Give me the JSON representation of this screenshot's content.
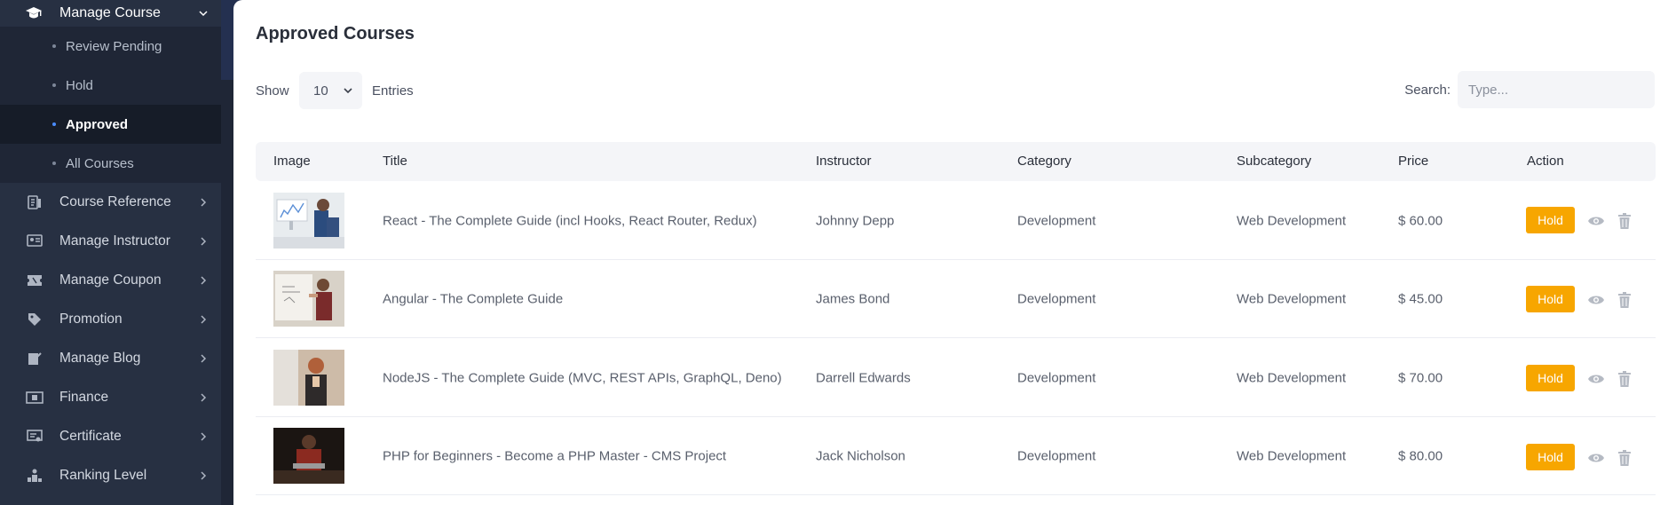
{
  "sidebar": {
    "parent": {
      "label": "Manage Course",
      "icon": "graduation-cap-icon"
    },
    "subitems": [
      {
        "label": "Review Pending"
      },
      {
        "label": "Hold"
      },
      {
        "label": "Approved",
        "active": true
      },
      {
        "label": "All Courses"
      }
    ],
    "items": [
      {
        "label": "Course Reference",
        "icon": "reference-icon"
      },
      {
        "label": "Manage Instructor",
        "icon": "instructor-icon"
      },
      {
        "label": "Manage Coupon",
        "icon": "coupon-icon"
      },
      {
        "label": "Promotion",
        "icon": "tag-icon"
      },
      {
        "label": "Manage Blog",
        "icon": "blog-icon"
      },
      {
        "label": "Finance",
        "icon": "money-icon"
      },
      {
        "label": "Certificate",
        "icon": "certificate-icon"
      },
      {
        "label": "Ranking Level",
        "icon": "ranking-icon"
      }
    ]
  },
  "main": {
    "title": "Approved Courses",
    "show_label": "Show",
    "entries_value": "10",
    "entries_label": "Entries",
    "search_label": "Search:",
    "search_placeholder": "Type..."
  },
  "table": {
    "headers": [
      "Image",
      "Title",
      "Instructor",
      "Category",
      "Subcategory",
      "Price",
      "Action"
    ],
    "rows": [
      {
        "title": "React - The Complete Guide (incl Hooks, React Router, Redux)",
        "instructor": "Johnny Depp",
        "category": "Development",
        "subcategory": "Web Development",
        "price": "$ 60.00",
        "action": "Hold"
      },
      {
        "title": "Angular - The Complete Guide",
        "instructor": "James Bond",
        "category": "Development",
        "subcategory": "Web Development",
        "price": "$ 45.00",
        "action": "Hold"
      },
      {
        "title": "NodeJS - The Complete Guide (MVC, REST APIs, GraphQL, Deno)",
        "instructor": "Darrell Edwards",
        "category": "Development",
        "subcategory": "Web Development",
        "price": "$ 70.00",
        "action": "Hold"
      },
      {
        "title": "PHP for Beginners - Become a PHP Master - CMS Project",
        "instructor": "Jack Nicholson",
        "category": "Development",
        "subcategory": "Web Development",
        "price": "$ 80.00",
        "action": "Hold"
      }
    ]
  },
  "colors": {
    "sidebar_bg": "#273042",
    "accent": "#f7a600",
    "active_dot": "#4a8cff"
  }
}
